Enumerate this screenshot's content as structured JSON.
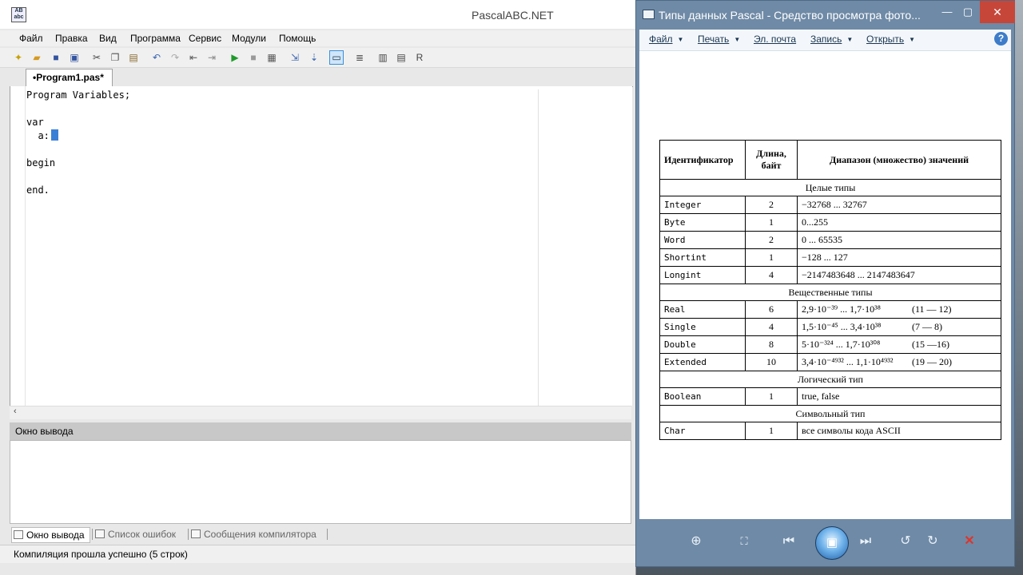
{
  "ide": {
    "title": "PascalABC.NET",
    "app_icon_text": "AB abc",
    "menu": [
      "Файл",
      "Правка",
      "Вид",
      "Программа",
      "Сервис",
      "Модули",
      "Помощь"
    ],
    "toolbar_icons": [
      "new-file-icon",
      "open-file-icon",
      "save-icon",
      "save-all-icon",
      "cut-icon",
      "copy-icon",
      "paste-icon",
      "undo-icon",
      "redo-icon",
      "outdent-icon",
      "indent-icon",
      "run-icon",
      "stop-icon",
      "debug-icon",
      "step-over-icon",
      "step-into-icon",
      "console-icon",
      "format-icon",
      "compile-icon",
      "rebuild-icon",
      "run-r-icon"
    ],
    "tab_label": "•Program1.pas*",
    "code_lines": [
      "Program Variables;",
      "",
      "var",
      "  a:",
      "",
      "begin",
      "",
      "end."
    ],
    "output_header": "Окно вывода",
    "bottom_tabs": [
      "Окно вывода",
      "Список ошибок",
      "Сообщения компилятора"
    ],
    "status_text": "Компиляция прошла успешно (5 строк)"
  },
  "viewer": {
    "title": "Типы данных Pascal - Средство просмотра фото...",
    "menu": [
      {
        "label": "Файл",
        "has_dropdown": true
      },
      {
        "label": "Печать",
        "has_dropdown": true
      },
      {
        "label": "Эл. почта",
        "has_dropdown": false
      },
      {
        "label": "Запись",
        "has_dropdown": true
      },
      {
        "label": "Открыть",
        "has_dropdown": true
      }
    ],
    "help_label": "?",
    "table": {
      "headers": [
        "Идентификатор",
        "Длина, байт",
        "Диапазон (множество) значений"
      ],
      "sections": [
        {
          "title": "Целые типы",
          "rows": [
            {
              "name": "Integer",
              "len": "2",
              "range": "−32768 ... 32767",
              "extra": ""
            },
            {
              "name": "Byte",
              "len": "1",
              "range": "0...255",
              "extra": ""
            },
            {
              "name": "Word",
              "len": "2",
              "range": "0 ... 65535",
              "extra": ""
            },
            {
              "name": "Shortint",
              "len": "1",
              "range": "−128 ... 127",
              "extra": ""
            },
            {
              "name": "Longint",
              "len": "4",
              "range": "−2147483648 ... 2147483647",
              "extra": ""
            }
          ]
        },
        {
          "title": "Вещественные типы",
          "rows": [
            {
              "name": "Real",
              "len": "6",
              "range": "2,9·10⁻³⁹ ... 1,7·10³⁸",
              "extra": "(11 — 12)"
            },
            {
              "name": "Single",
              "len": "4",
              "range": "1,5·10⁻⁴⁵ ... 3,4·10³⁸",
              "extra": "(7 — 8)"
            },
            {
              "name": "Double",
              "len": "8",
              "range": "5·10⁻³²⁴ ... 1,7·10³⁰⁸",
              "extra": "(15 —16)"
            },
            {
              "name": "Extended",
              "len": "10",
              "range": "3,4·10⁻⁴⁹³² ... 1,1·10⁴⁹³²",
              "extra": "(19 — 20)"
            }
          ]
        },
        {
          "title": "Логический тип",
          "rows": [
            {
              "name": "Boolean",
              "len": "1",
              "range": "true, false",
              "extra": ""
            }
          ]
        },
        {
          "title": "Символьный тип",
          "rows": [
            {
              "name": "Char",
              "len": "1",
              "range": "все символы кода ASCII",
              "extra": ""
            }
          ]
        }
      ]
    },
    "controls": [
      "zoom-icon",
      "fit-icon",
      "previous-icon",
      "slideshow-icon",
      "next-icon",
      "rotate-left-icon",
      "rotate-right-icon",
      "delete-icon"
    ]
  }
}
